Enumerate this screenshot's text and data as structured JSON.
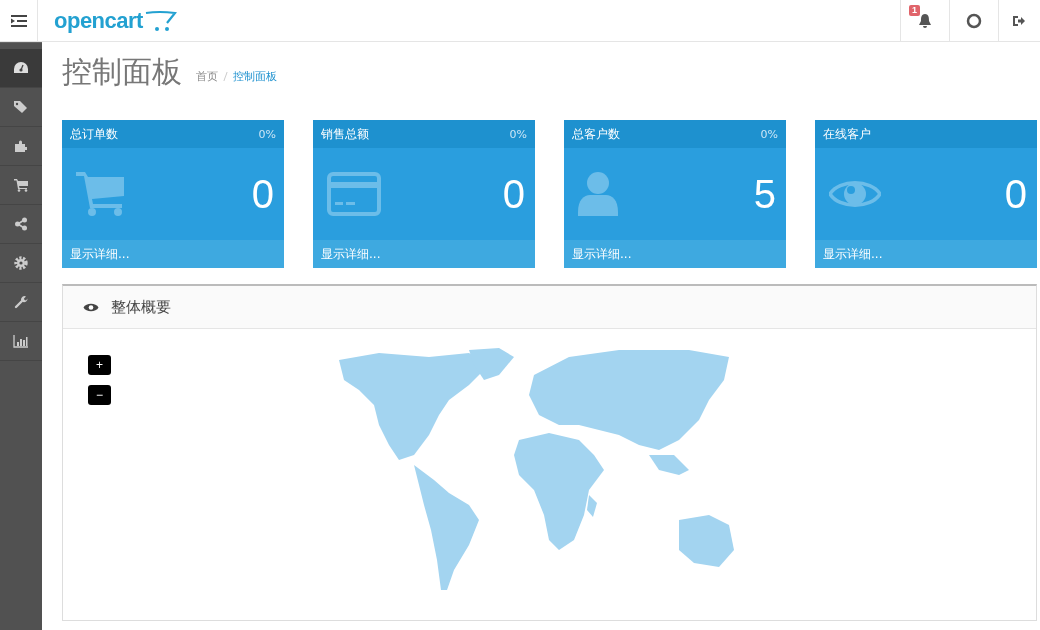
{
  "header": {
    "logo": "opencart",
    "notification_badge": "1"
  },
  "sidebar": {
    "items": [
      {
        "kind": "dashboard",
        "selected": true
      },
      {
        "kind": "tags",
        "selected": false
      },
      {
        "kind": "puzzle",
        "selected": false
      },
      {
        "kind": "cart",
        "selected": false
      },
      {
        "kind": "share",
        "selected": false
      },
      {
        "kind": "gear",
        "selected": false
      },
      {
        "kind": "wrench",
        "selected": false
      },
      {
        "kind": "chart",
        "selected": false
      }
    ]
  },
  "page": {
    "title": "控制面板",
    "breadcrumb": [
      {
        "label": "首页",
        "selected": false
      },
      {
        "label": "控制面板",
        "selected": true
      }
    ]
  },
  "stats": [
    {
      "title": "总订单数",
      "percent": "0%",
      "value": "0",
      "kind": "cart",
      "footer": "显示详细..."
    },
    {
      "title": "销售总额",
      "percent": "0%",
      "value": "0",
      "kind": "card",
      "footer": "显示详细..."
    },
    {
      "title": "总客户数",
      "percent": "0%",
      "value": "5",
      "kind": "user",
      "footer": "显示详细..."
    },
    {
      "title": "在线客户",
      "value": "0",
      "kind": "eye",
      "footer": "显示详细..."
    }
  ],
  "map_panel": {
    "title": "整体概要",
    "zoom_in": "+",
    "zoom_out": "−"
  }
}
